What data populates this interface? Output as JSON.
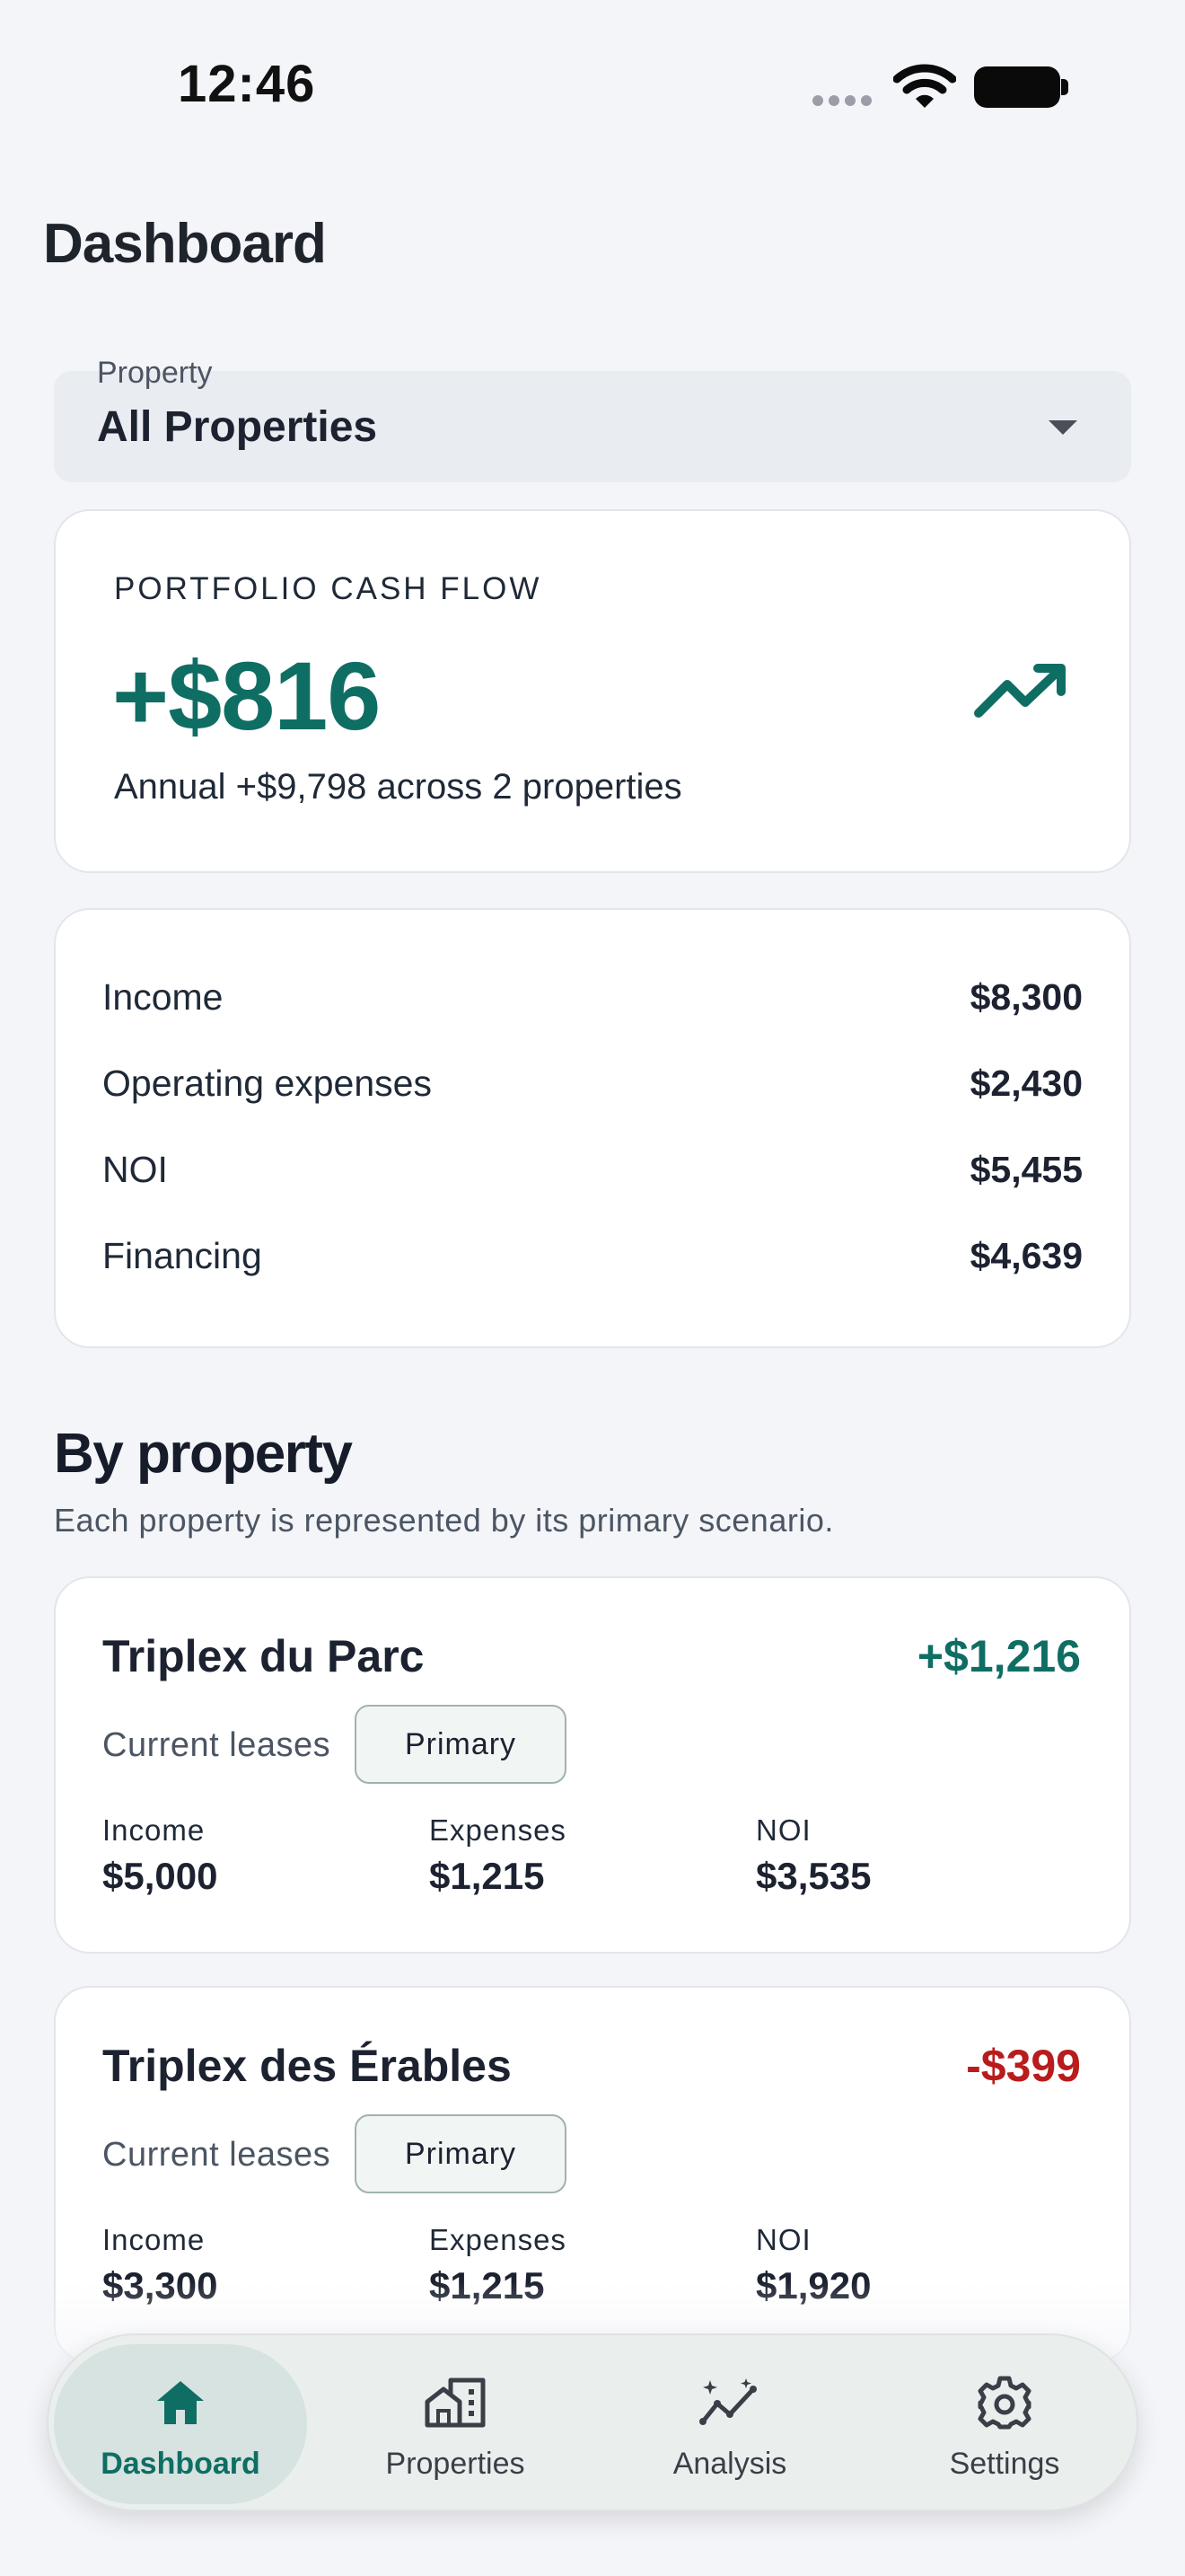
{
  "status_bar": {
    "time": "12:46"
  },
  "header": {
    "title": "Dashboard"
  },
  "property_select": {
    "label": "Property",
    "value": "All Properties"
  },
  "portfolio": {
    "label": "PORTFOLIO CASH FLOW",
    "value": "+$816",
    "subtitle": "Annual +$9,798 across 2 properties",
    "trend_icon": "trending-up-icon",
    "accent_color": "#0f6e63"
  },
  "summary": [
    {
      "label": "Income",
      "value": "$8,300"
    },
    {
      "label": "Operating expenses",
      "value": "$2,430"
    },
    {
      "label": "NOI",
      "value": "$5,455"
    },
    {
      "label": "Financing",
      "value": "$4,639"
    }
  ],
  "by_property": {
    "title": "By property",
    "subtitle": "Each property is represented by its primary scenario.",
    "properties": [
      {
        "name": "Triplex du Parc",
        "cash_flow": "+$1,216",
        "scenario": "Current leases",
        "badge": "Primary",
        "metrics": [
          {
            "label": "Income",
            "value": "$5,000"
          },
          {
            "label": "Expenses",
            "value": "$1,215"
          },
          {
            "label": "NOI",
            "value": "$3,535"
          }
        ]
      },
      {
        "name": "Triplex des Érables",
        "cash_flow": "-$399",
        "scenario": "Current leases",
        "badge": "Primary",
        "metrics": [
          {
            "label": "Income",
            "value": "$3,300"
          },
          {
            "label": "Expenses",
            "value": "$1,215"
          },
          {
            "label": "NOI",
            "value": "$1,920"
          }
        ]
      }
    ]
  },
  "nav": {
    "items": [
      {
        "label": "Dashboard",
        "icon": "home-icon",
        "active": true
      },
      {
        "label": "Properties",
        "icon": "building-icon",
        "active": false
      },
      {
        "label": "Analysis",
        "icon": "sparkle-chart-icon",
        "active": false
      },
      {
        "label": "Settings",
        "icon": "gear-icon",
        "active": false
      }
    ]
  },
  "colors": {
    "positive": "#0f6e63",
    "negative": "#b91c1c",
    "background": "#f4f5f9"
  }
}
